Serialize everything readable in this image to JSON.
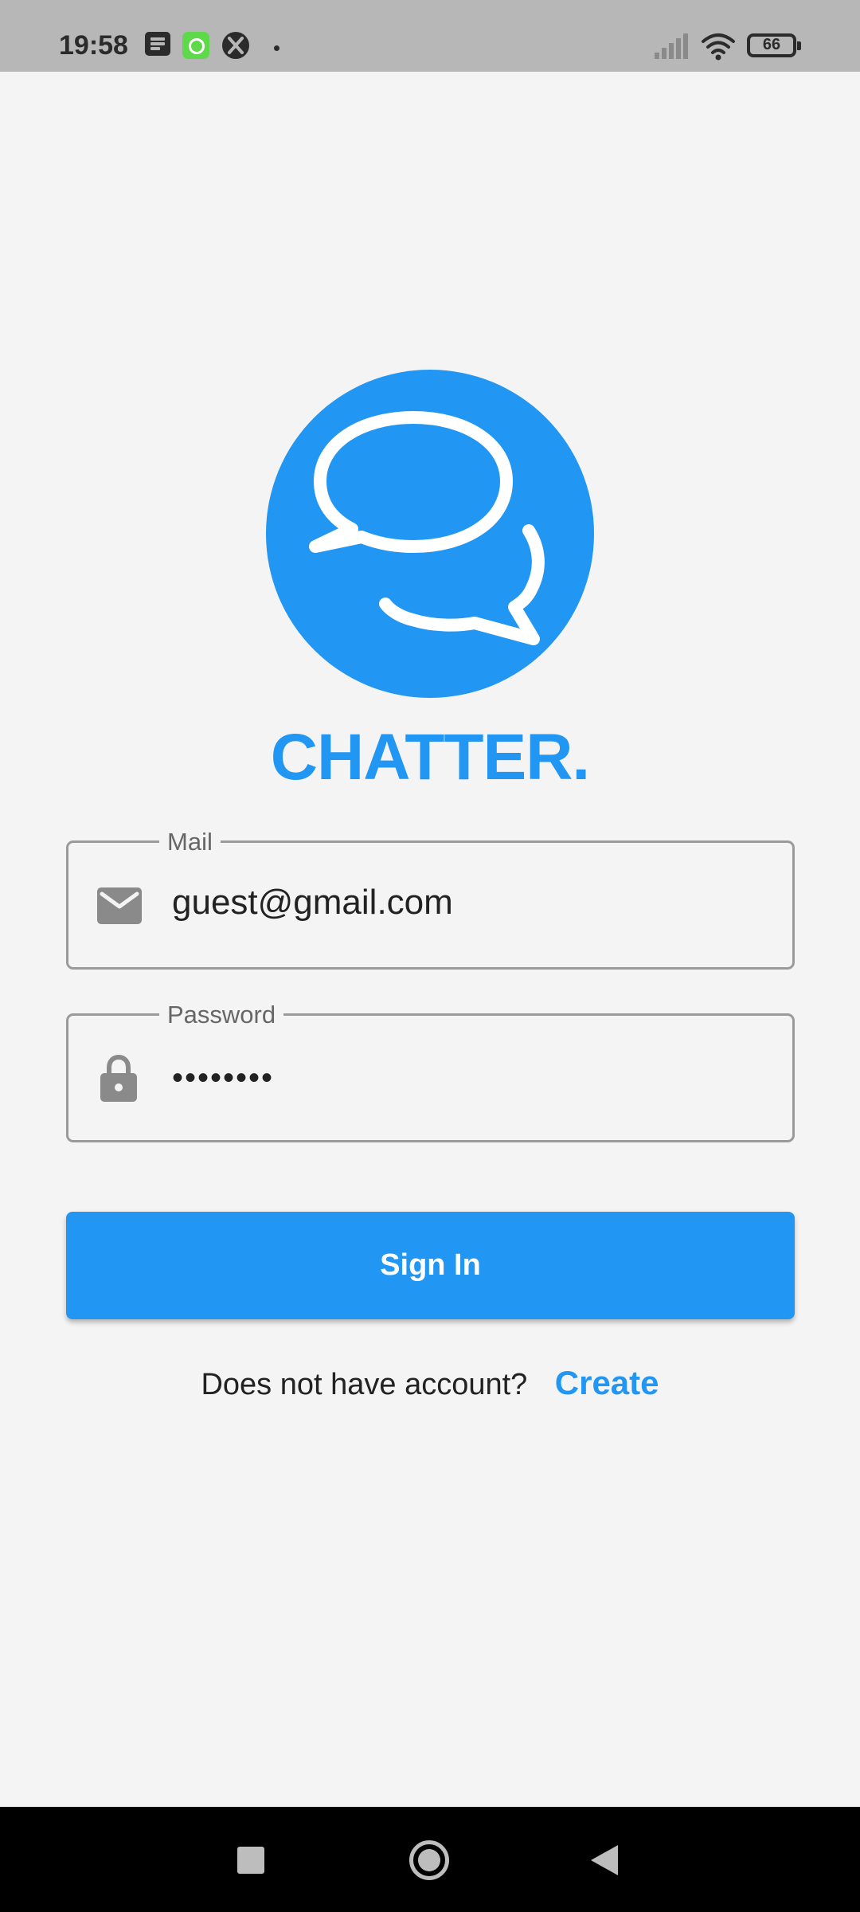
{
  "status_bar": {
    "time": "19:58",
    "battery": "66",
    "icons": [
      "news-icon",
      "clock-app-icon",
      "xbox-icon",
      "dot-icon",
      "signal-icon",
      "wifi-icon",
      "battery-icon"
    ]
  },
  "app": {
    "title": "CHATTER.",
    "logo": "chat-bubbles-icon",
    "brand_color": "#2196f2"
  },
  "form": {
    "mail": {
      "label": "Mail",
      "value": "guest@gmail.com",
      "icon": "mail-icon"
    },
    "password": {
      "label": "Password",
      "value": "••••••••",
      "icon": "lock-icon"
    },
    "sign_in_label": "Sign In",
    "signup_prompt": "Does not have account?",
    "signup_link": "Create"
  },
  "nav_bar": {
    "buttons": [
      "recent-apps-icon",
      "home-icon",
      "back-icon"
    ]
  }
}
